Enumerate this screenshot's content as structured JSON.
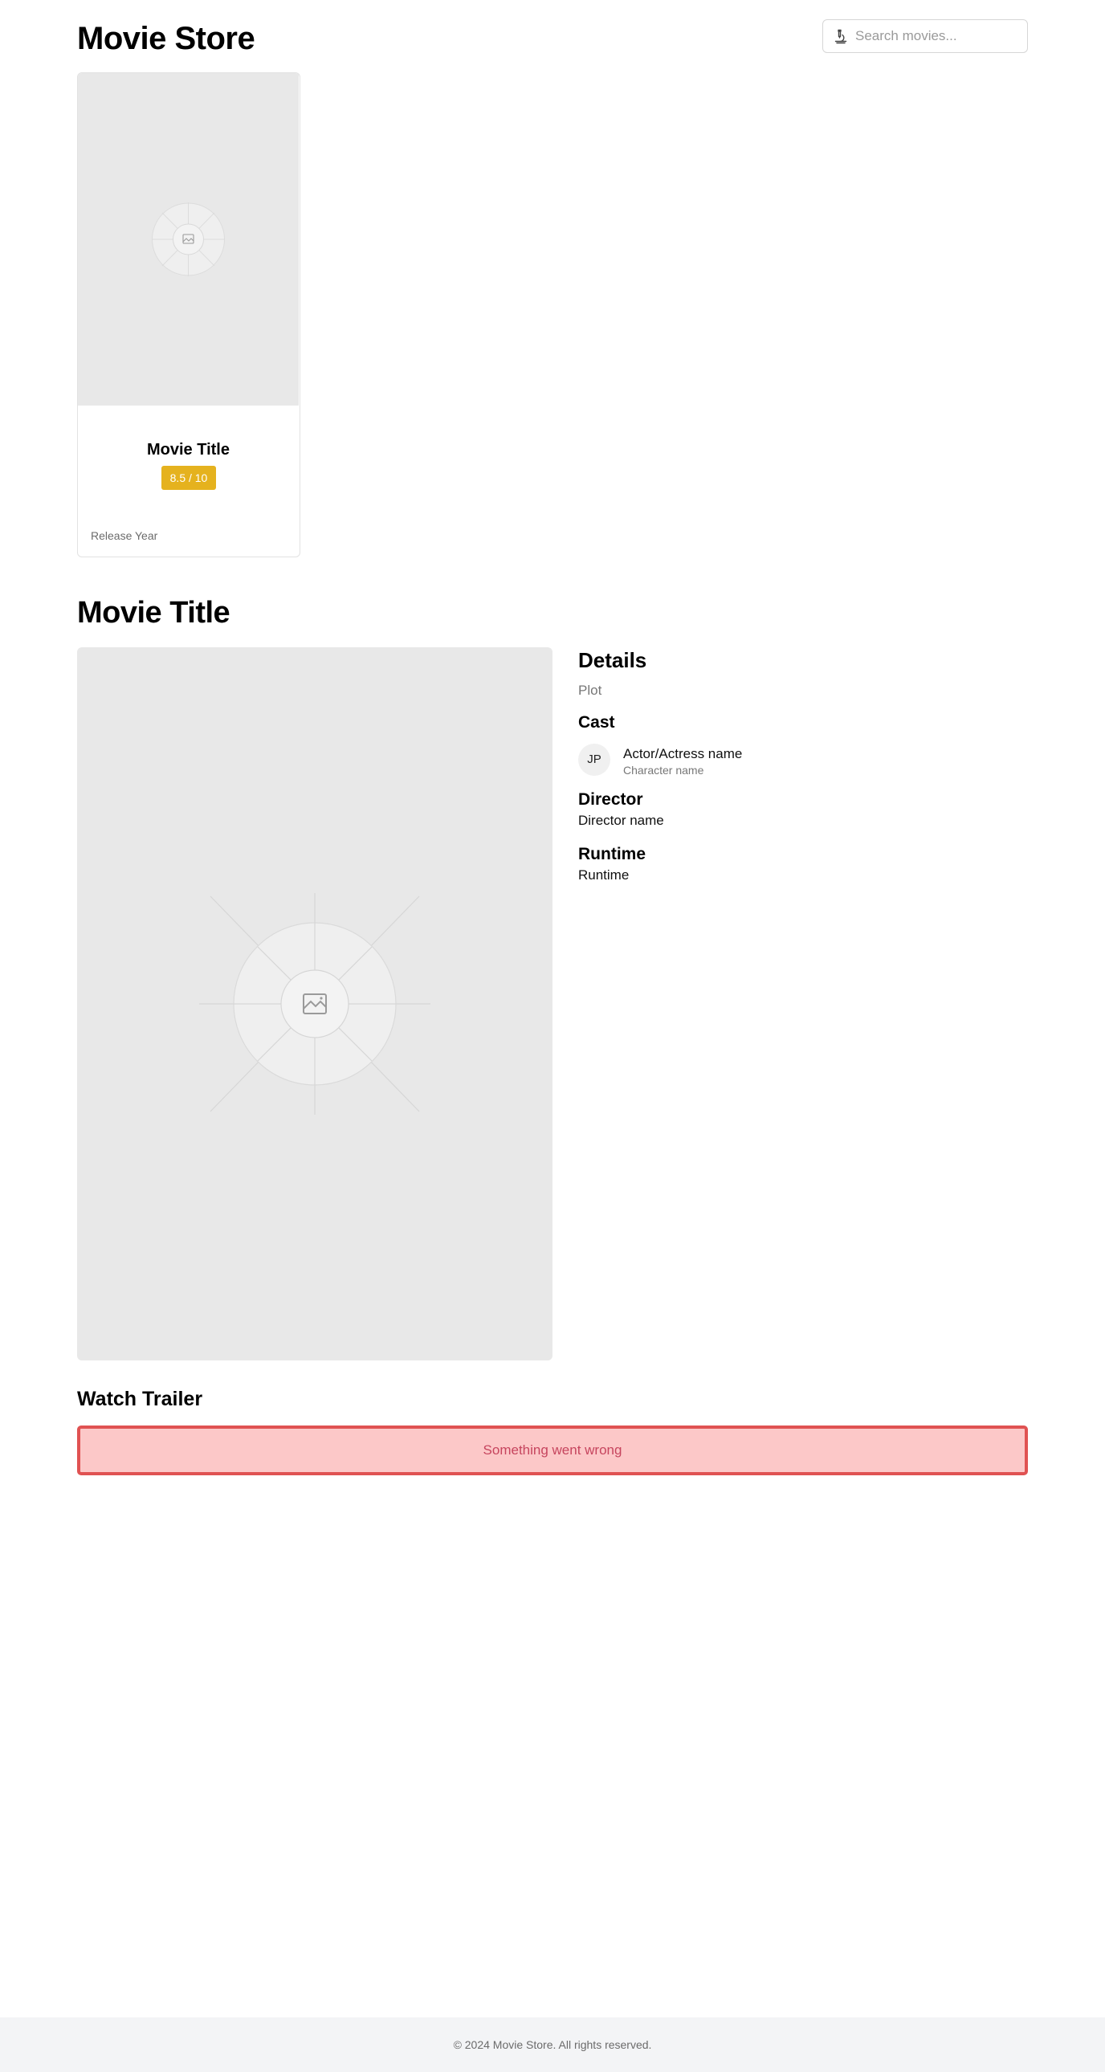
{
  "header": {
    "site_title": "Movie Store",
    "search_placeholder": "Search movies...",
    "search_icon": "microscope-icon"
  },
  "card": {
    "title": "Movie Title",
    "rating": "8.5 / 10",
    "release_year": "Release Year",
    "poster_icon": "image-placeholder-icon"
  },
  "details": {
    "title": "Movie Title",
    "details_heading": "Details",
    "plot": "Plot",
    "cast_heading": "Cast",
    "cast": [
      {
        "initials": "JP",
        "name": "Actor/Actress name",
        "character": "Character name"
      }
    ],
    "director_heading": "Director",
    "director": "Director name",
    "runtime_heading": "Runtime",
    "runtime": "Runtime"
  },
  "trailer": {
    "heading": "Watch Trailer",
    "error": "Something went wrong"
  },
  "footer": {
    "text": "© 2024 Movie Store. All rights reserved."
  },
  "colors": {
    "rating_badge": "#e5b21e",
    "error_background": "#fcc8c8",
    "error_border": "#e05252",
    "error_text": "#c6455e",
    "placeholder_gray": "#e8e8e8",
    "footer_background": "#f3f4f6"
  }
}
